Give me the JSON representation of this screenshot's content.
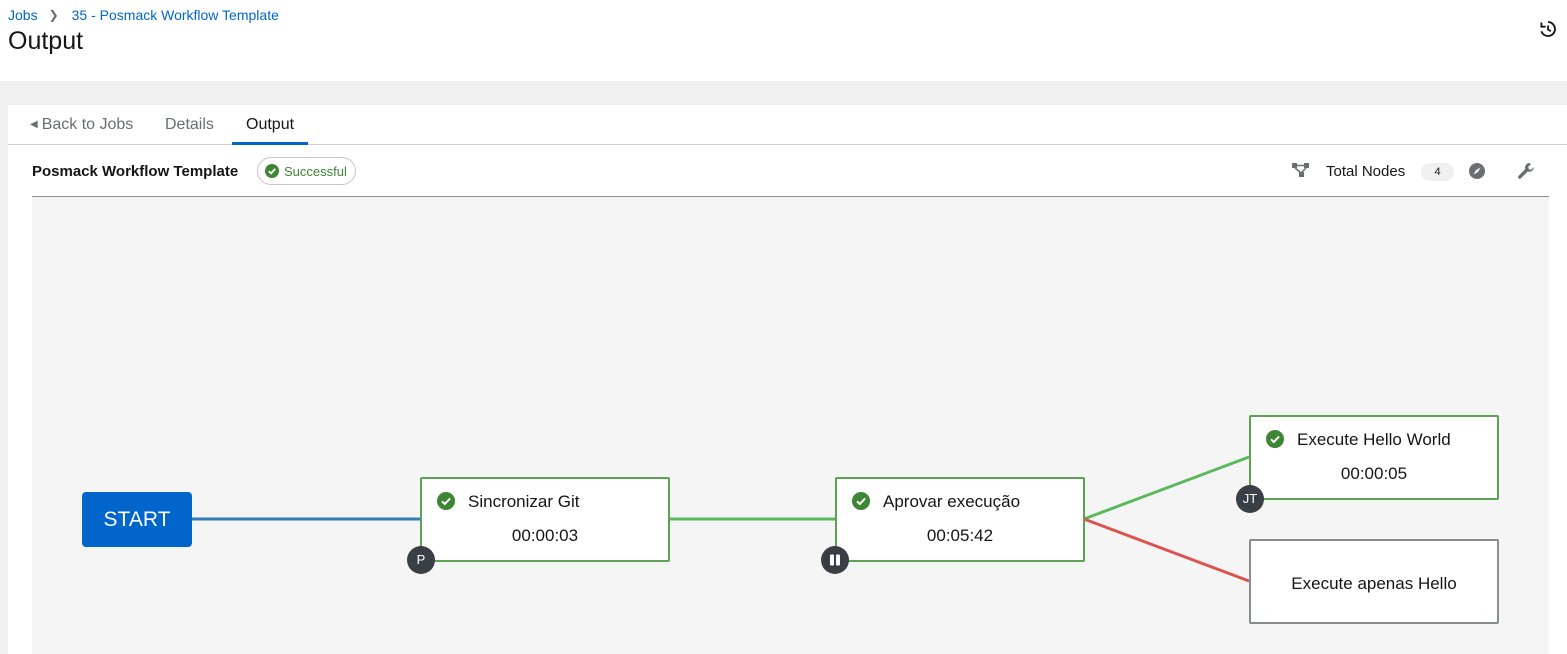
{
  "breadcrumb": {
    "root": "Jobs",
    "current": "35 - Posmack Workflow Template"
  },
  "page": {
    "title": "Output"
  },
  "tabs": [
    {
      "label": "Back to Jobs"
    },
    {
      "label": "Details"
    },
    {
      "label": "Output"
    }
  ],
  "toolbar": {
    "workflow_name": "Posmack Workflow Template",
    "status": "Successful",
    "total_nodes_label": "Total Nodes",
    "total_nodes_count": "4"
  },
  "graph": {
    "start_label": "START",
    "nodes": [
      {
        "title": "Sincronizar Git",
        "time": "00:00:03",
        "type_badge": "P",
        "status": "successful"
      },
      {
        "title": "Aprovar execução",
        "time": "00:05:42",
        "type_badge": "pause",
        "status": "successful"
      },
      {
        "title": "Execute Hello World",
        "time": "00:00:05",
        "type_badge": "JT",
        "status": "successful"
      },
      {
        "title": "Execute apenas Hello",
        "time": "",
        "type_badge": "",
        "status": "not-run"
      }
    ],
    "link_colors": {
      "always": "#337ab7",
      "success": "#5cb85c",
      "failure": "#d9534f"
    }
  },
  "colors": {
    "accent": "#0066cc",
    "success": "#3e8635",
    "node_success_border": "#5ba352"
  }
}
